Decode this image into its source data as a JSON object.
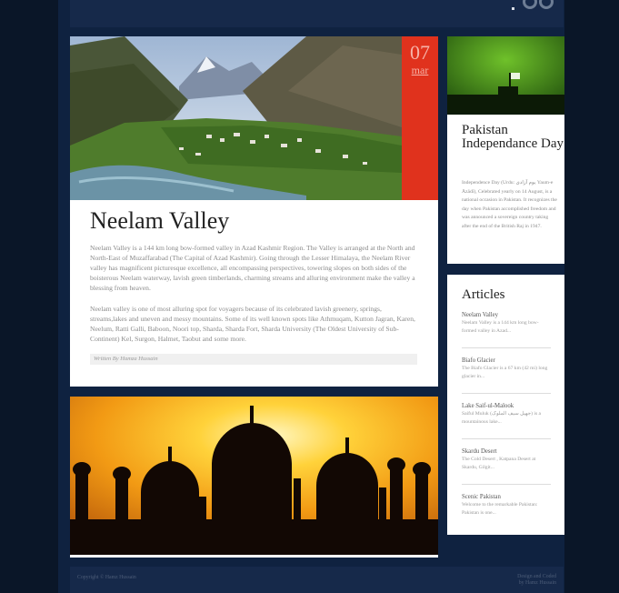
{
  "post1": {
    "day": "07",
    "month": "mar",
    "title": "Neelam Valley",
    "para1": "Neelam Valley is a 144 km long bow-formed valley in Azad Kashmir Region. The Valley is arranged at the North and North-East of Muzaffarabad (The Capital of Azad Kashmir). Going through the Lesser Himalaya, the Neelam River valley has magnificent picturesque excellence, all encompassing perspectives, towering slopes on both sides of the boisterous Neelam waterway, lavish green timberlands, charming streams and alluring environment make the valley a blessing from heaven.",
    "para2": "Neelam valley is one of most alluring spot for voyagers because of its celebrated lavish greenery, springs, streams,lakes and uneven and messy mountains. Some of its well known spots like Athmuqam, Kutton Jagran, Karen, Neelum, Ratti Galli, Baboon, Noori top, Sharda, Sharda Fort, Sharda University (The Oldest University of Sub-Continent) Kel, Surgon, Halmet, Taobut and some more.",
    "byline": "Written By Hamza Hussain"
  },
  "card1": {
    "title": "Pakistan Independance Day",
    "description": "Independence Day (Urdu: یوم آزادی‎ Yaum-e Āzādī), Celebrated yearly on 14 August, is a national occasion in Pakistan. It recognizes the day when Pakistan accomplished freedom and was announced a sovereign country taking after the end of the British Raj in 1947."
  },
  "card2": {
    "title": "Articles",
    "items": [
      {
        "title": "Neelam Valley",
        "snippet": "Neelam Valley is a 144 km long bow-formed valley in Azad..."
      },
      {
        "title": "Biafo Glacier",
        "snippet": "The Biafo Glacier is a 67 km (42 mi) long glacier in..."
      },
      {
        "title": "Lake Saif-ul-Malook",
        "snippet": "Saiful Muluk (جھیل سیف الملوک) is a mountainous lake..."
      },
      {
        "title": "Skardu Desert",
        "snippet": "The Cold Desert , Katpana Desert at Skardu, Gilgit..."
      },
      {
        "title": "Scenic Pakistan",
        "snippet": "Welcome to the remarkable Pakistan: Pakistan is one..."
      }
    ]
  },
  "footer": {
    "copyright": "Copyright © Hamz Hussain",
    "credit_line1": "Design and Coded",
    "credit_line2": "by Hamz Hussain"
  },
  "colors": {
    "accent": "#e0321d",
    "background": "#0c1a31",
    "panel": "#16294a"
  }
}
